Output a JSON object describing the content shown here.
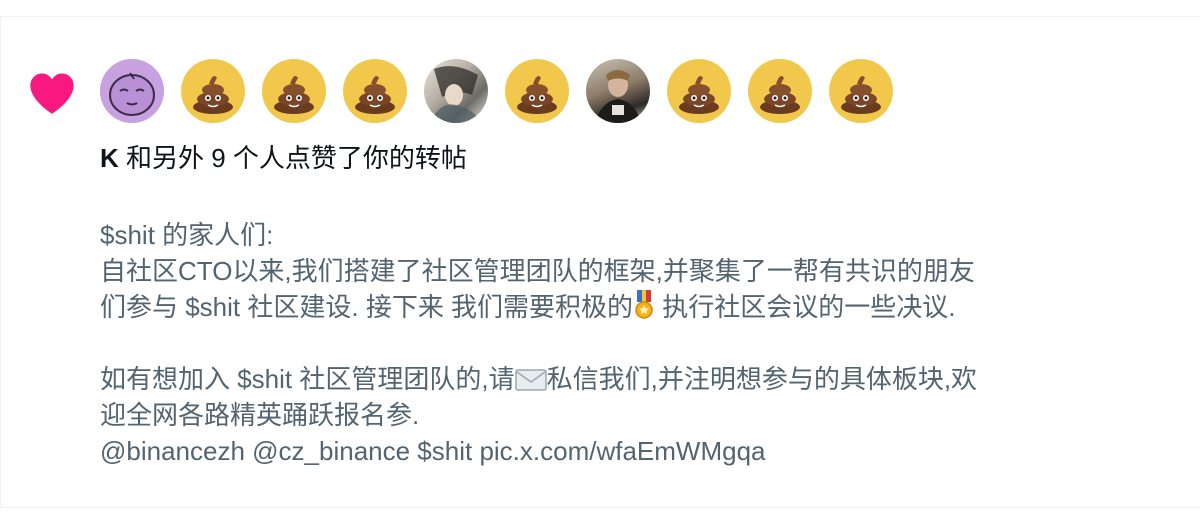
{
  "notification": {
    "type_icon": "heart-icon",
    "accent_color": "#f91880",
    "avatars": [
      {
        "kind": "purple-face"
      },
      {
        "kind": "poop-emoji"
      },
      {
        "kind": "poop-emoji"
      },
      {
        "kind": "poop-emoji"
      },
      {
        "kind": "photo"
      },
      {
        "kind": "poop-emoji"
      },
      {
        "kind": "photo"
      },
      {
        "kind": "poop-emoji"
      },
      {
        "kind": "poop-emoji"
      },
      {
        "kind": "poop-emoji"
      }
    ],
    "actor_name": "K",
    "action_text": " 和另外 9 个人点赞了你的转帖",
    "post": {
      "line1": "$shit 的家人们:",
      "line2": "自社区CTO以来,我们搭建了社区管理团队的框架,并聚集了一帮有共识的朋友",
      "line3_a": "们参与 $shit 社区建设. 接下来 我们需要积极的",
      "line3_emoji": "medal-icon",
      "line3_b": " 执行社区会议的一些决议.",
      "line4_a": "如有想加入 $shit 社区管理团队的,请",
      "line4_emoji": "envelope-icon",
      "line4_b": "私信我们,并注明想参与的具体板块,欢",
      "line5": "迎全网各路精英踊跃报名参.",
      "line6": "@binancezh @cz_binance $shit pic.x.com/wfaEmWMgqa"
    }
  }
}
